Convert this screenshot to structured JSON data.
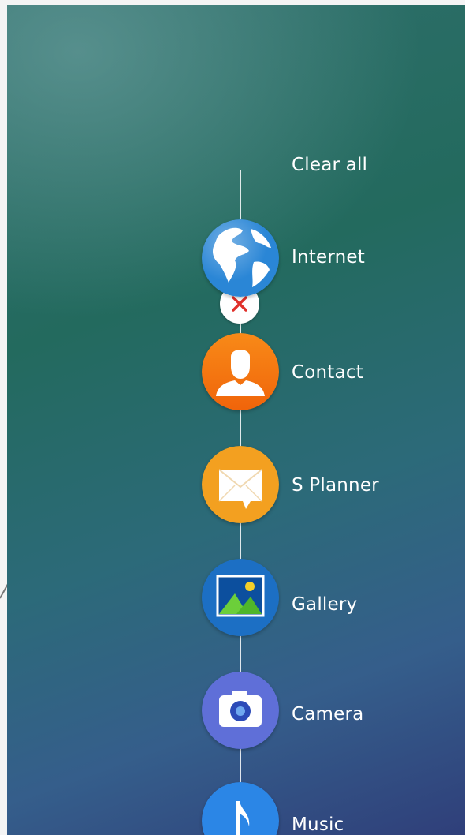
{
  "clear_all": {
    "label": "Clear all",
    "icon": "close-icon"
  },
  "apps": [
    {
      "label": "Internet",
      "icon": "globe-icon"
    },
    {
      "label": "Contact",
      "icon": "person-icon"
    },
    {
      "label": "S Planner",
      "icon": "envelope-icon"
    },
    {
      "label": "Gallery",
      "icon": "picture-icon"
    },
    {
      "label": "Camera",
      "icon": "camera-icon"
    },
    {
      "label": "Music",
      "icon": "music-note-icon"
    }
  ],
  "colors": {
    "internet": "#2a86d6",
    "contact": "#f27a12",
    "splanner": "#f3a020",
    "gallery": "#1c6fc4",
    "camera": "#5f6fd8",
    "music": "#2b86e6",
    "clear_x": "#e0302a"
  }
}
